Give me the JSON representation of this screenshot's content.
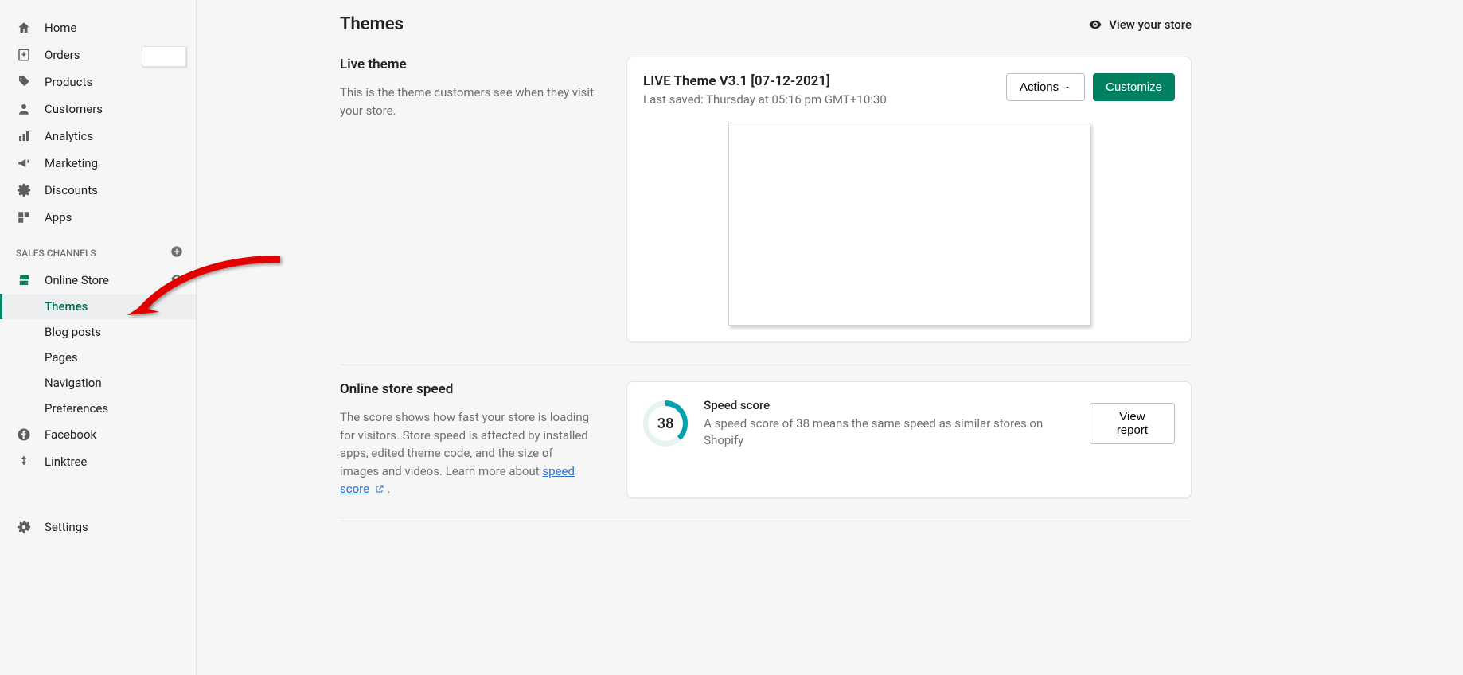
{
  "sidebar": {
    "nav": [
      {
        "label": "Home"
      },
      {
        "label": "Orders"
      },
      {
        "label": "Products"
      },
      {
        "label": "Customers"
      },
      {
        "label": "Analytics"
      },
      {
        "label": "Marketing"
      },
      {
        "label": "Discounts"
      },
      {
        "label": "Apps"
      }
    ],
    "section_heading": "SALES CHANNELS",
    "online_store": "Online Store",
    "sub": [
      {
        "label": "Themes",
        "active": true
      },
      {
        "label": "Blog posts"
      },
      {
        "label": "Pages"
      },
      {
        "label": "Navigation"
      },
      {
        "label": "Preferences"
      }
    ],
    "channels": [
      {
        "label": "Facebook"
      },
      {
        "label": "Linktree"
      }
    ],
    "settings": "Settings"
  },
  "header": {
    "title": "Themes",
    "view_store": "View your store"
  },
  "live_theme": {
    "heading": "Live theme",
    "description": "This is the theme customers see when they visit your store.",
    "theme_name": "LIVE Theme V3.1 [07-12-2021]",
    "last_saved": "Last saved: Thursday at 05:16 pm GMT+10:30",
    "actions_label": "Actions",
    "customize_label": "Customize"
  },
  "speed": {
    "heading": "Online store speed",
    "description_1": "The score shows how fast your store is loading for visitors. Store speed is affected by installed apps, edited theme code, and the size of images and videos. Learn more about ",
    "link_text": "speed score",
    "period": " .",
    "score": "38",
    "score_title": "Speed score",
    "score_desc": "A speed score of 38 means the same speed as similar stores on Shopify",
    "view_report": "View report"
  }
}
